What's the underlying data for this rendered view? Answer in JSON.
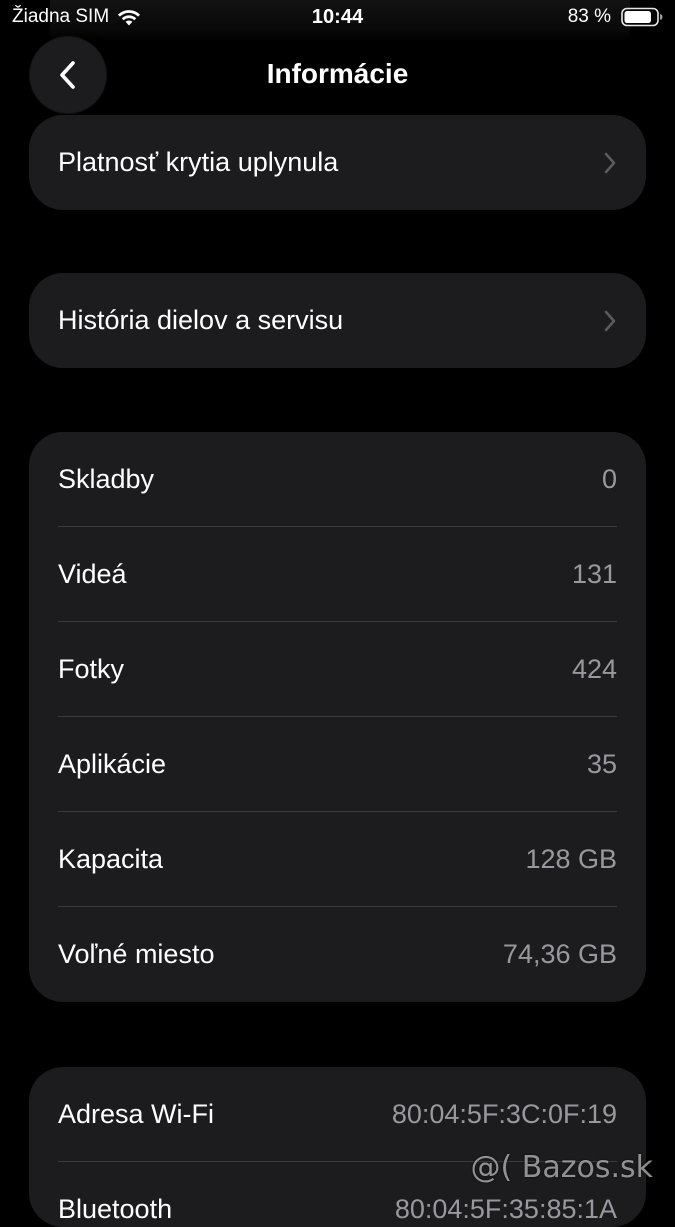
{
  "status_bar": {
    "carrier": "Žiadna SIM",
    "time": "10:44",
    "battery": "83 %"
  },
  "nav": {
    "title": "Informácie",
    "back_icon": "chevron-left-icon"
  },
  "links": [
    {
      "label": "Platnosť krytia uplynula"
    },
    {
      "label": "História dielov a servisu"
    }
  ],
  "media_stats": [
    {
      "label": "Skladby",
      "value": "0"
    },
    {
      "label": "Videá",
      "value": "131"
    },
    {
      "label": "Fotky",
      "value": "424"
    },
    {
      "label": "Aplikácie",
      "value": "35"
    },
    {
      "label": "Kapacita",
      "value": "128 GB"
    },
    {
      "label": "Voľné miesto",
      "value": "74,36 GB"
    }
  ],
  "network": [
    {
      "label": "Adresa Wi-Fi",
      "value": "80:04:5F:3C:0F:19"
    },
    {
      "label": "Bluetooth",
      "value": "80:04:5F:35:85:1A"
    }
  ],
  "watermark": "@( Bazos.sk",
  "colors": {
    "background": "#000000",
    "cell": "#1c1c1e",
    "secondary_text": "#98989e",
    "separator": "#3a3a3c"
  }
}
